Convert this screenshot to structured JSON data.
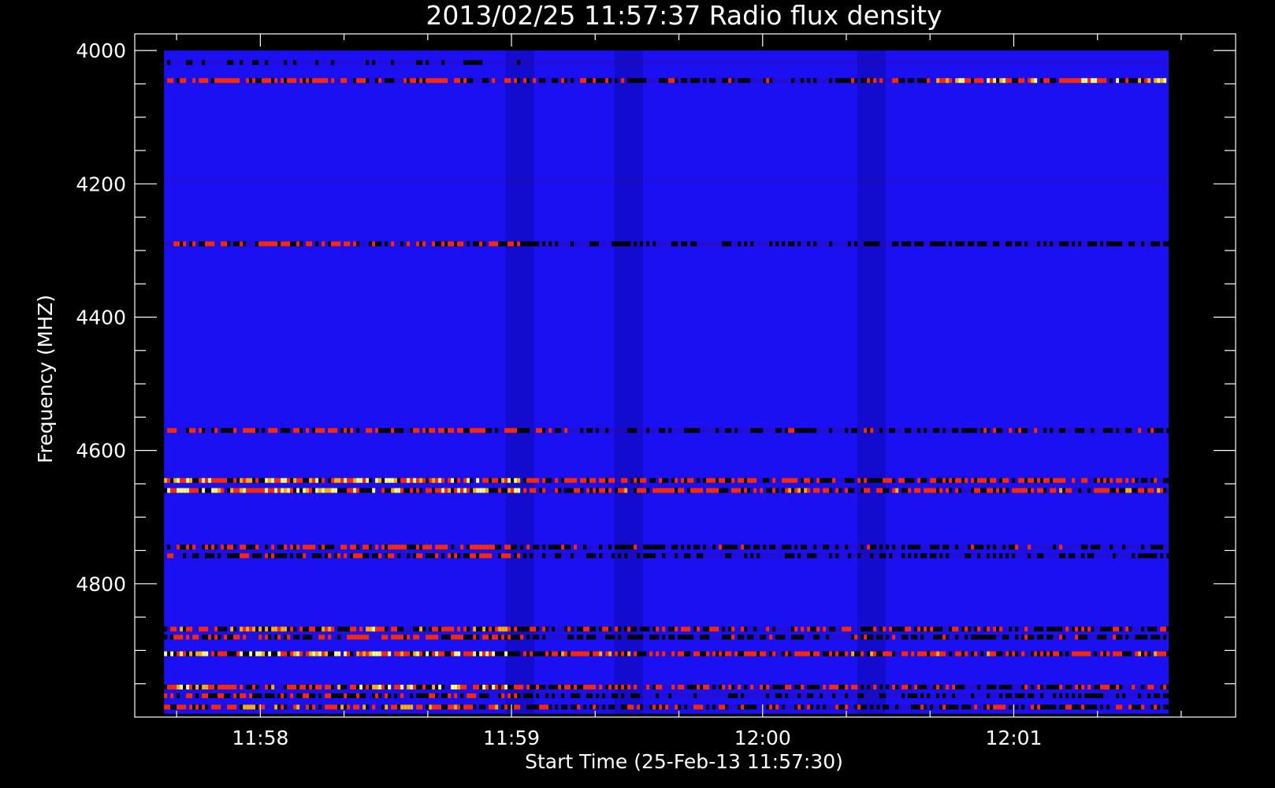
{
  "chart_data": {
    "type": "heatmap",
    "title": "2013/02/25 11:57:37 Radio flux density",
    "xlabel": "Start Time (25-Feb-13 11:57:30)",
    "ylabel": "Frequency (MHZ)",
    "x_unit": "time (hh:mm)",
    "y_unit": "MHz",
    "xlim": [
      "11:57:30",
      "12:01:53"
    ],
    "ylim": [
      3975,
      5000
    ],
    "y_reversed": true,
    "x_ticks": [
      "11:58",
      "11:59",
      "12:00",
      "12:01"
    ],
    "y_ticks": [
      4000,
      4200,
      4400,
      4600,
      4800
    ],
    "y_minor_step": 50,
    "x_minor_step_seconds": 20,
    "data_extent": {
      "start_time": "11:57:37",
      "end_time": "12:01:37",
      "freq_min": 4000,
      "freq_max": 4995
    },
    "background_color": "#1a10f2",
    "colormap": [
      "#000000",
      "#1a10f2",
      "#ff2a00",
      "#ffb000",
      "#ffff80"
    ],
    "bands": [
      {
        "freq": 4018,
        "intensity": 0.3
      },
      {
        "freq": 4045,
        "intensity": 0.65,
        "late_intensity": 0.85
      },
      {
        "freq": 4195,
        "intensity": 0.2
      },
      {
        "freq": 4290,
        "intensity": 0.55
      },
      {
        "freq": 4570,
        "intensity": 0.6
      },
      {
        "freq": 4645,
        "intensity": 0.85
      },
      {
        "freq": 4660,
        "intensity": 0.95
      },
      {
        "freq": 4745,
        "intensity": 0.6
      },
      {
        "freq": 4758,
        "intensity": 0.5
      },
      {
        "freq": 4868,
        "intensity": 0.75
      },
      {
        "freq": 4880,
        "intensity": 0.6
      },
      {
        "freq": 4905,
        "intensity": 0.95
      },
      {
        "freq": 4955,
        "intensity": 0.8
      },
      {
        "freq": 4968,
        "intensity": 0.5
      },
      {
        "freq": 4985,
        "intensity": 0.7
      }
    ],
    "dark_time_columns": [
      "11:59:02",
      "11:59:28",
      "12:00:26"
    ],
    "grid": false,
    "legend": "none"
  }
}
